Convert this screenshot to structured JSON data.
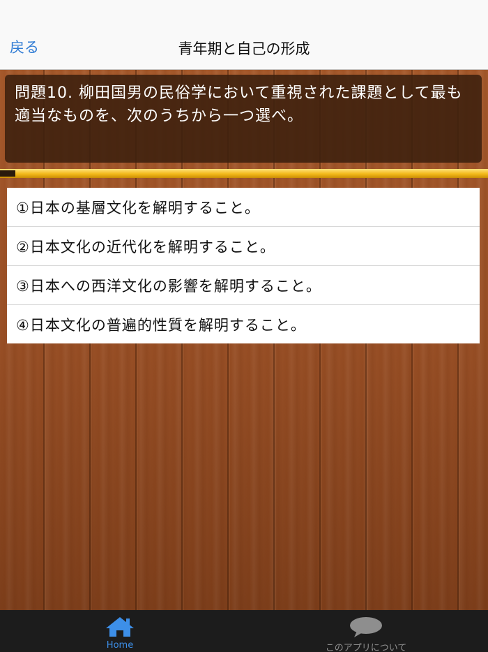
{
  "nav": {
    "back_label": "戻る",
    "title": "青年期と自己の形成"
  },
  "question": {
    "text": "問題10. 柳田国男の民俗学において重視された課題として最も適当なものを、次のうちから一つ選べ。"
  },
  "progress": {
    "fraction": 1.0
  },
  "choices": [
    {
      "label": "①日本の基層文化を解明すること。"
    },
    {
      "label": "②日本文化の近代化を解明すること。"
    },
    {
      "label": "③日本への西洋文化の影響を解明すること。"
    },
    {
      "label": "④日本文化の普遍的性質を解明すること。"
    }
  ],
  "tabbar": {
    "tabs": [
      {
        "label": "Home",
        "icon": "home-icon",
        "active": true
      },
      {
        "label": "このアプリについて",
        "icon": "speech-bubble-icon",
        "active": false
      }
    ]
  },
  "colors": {
    "accent": "#3d8fe8",
    "back_link": "#2f7bd4",
    "progress": "#f2b91a"
  }
}
